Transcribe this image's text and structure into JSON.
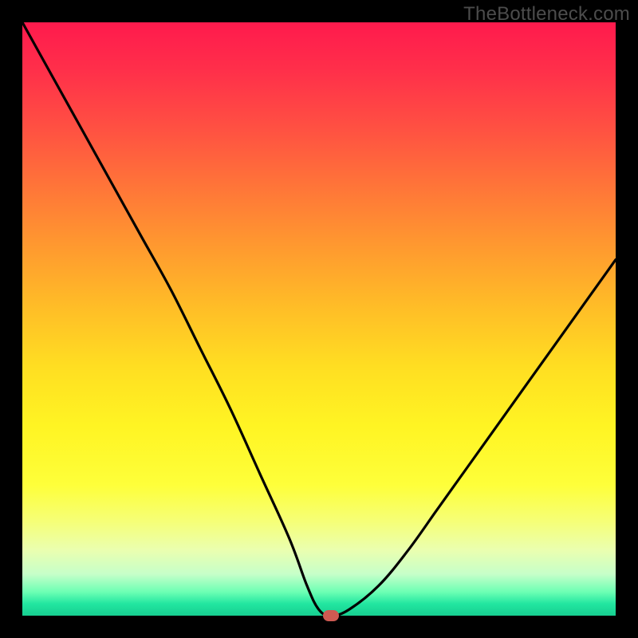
{
  "watermark": "TheBottleneck.com",
  "chart_data": {
    "type": "line",
    "title": "",
    "xlabel": "",
    "ylabel": "",
    "xlim": [
      0,
      100
    ],
    "ylim": [
      0,
      100
    ],
    "grid": false,
    "legend": false,
    "background_gradient": {
      "top": "#ff1a4d",
      "mid": "#ffde22",
      "bottom": "#17cf91"
    },
    "series": [
      {
        "name": "bottleneck-curve",
        "color": "#000000",
        "x": [
          0,
          5,
          10,
          15,
          20,
          25,
          30,
          35,
          40,
          45,
          48,
          50,
          52,
          55,
          60,
          65,
          70,
          75,
          80,
          85,
          90,
          95,
          100
        ],
        "y": [
          100,
          91,
          82,
          73,
          64,
          55,
          45,
          35,
          24,
          13,
          5,
          1,
          0,
          1,
          5,
          11,
          18,
          25,
          32,
          39,
          46,
          53,
          60
        ]
      }
    ],
    "annotations": [
      {
        "name": "optimal-marker",
        "x": 52,
        "y": 0,
        "color": "#cf5a52",
        "shape": "pill"
      }
    ]
  }
}
